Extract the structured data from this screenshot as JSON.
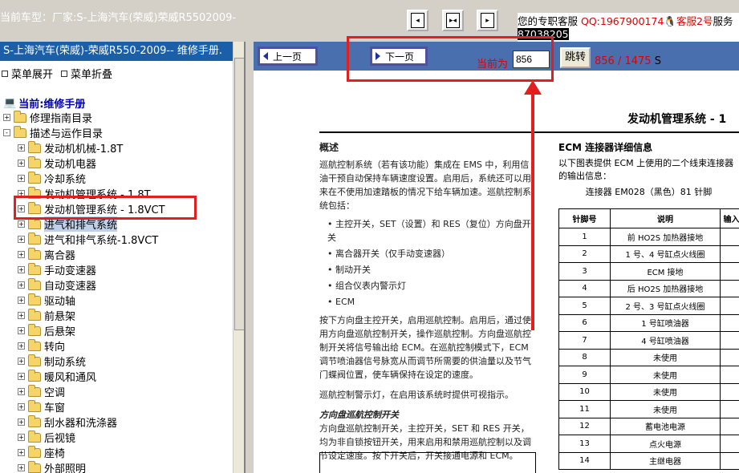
{
  "topbar": {
    "car_model": "当前车型：厂家:S-上海汽车(荣威)荣威R5502009-",
    "service_label": "您的专职客服",
    "qq": "QQ:1967900174",
    "csr": "客服2号",
    "csr_suffix": "服务",
    "phone": "87038205"
  },
  "tree": {
    "title": "S-上海汽车(荣威)-荣威R550-2009-- 维修手册.",
    "expand_all": "菜单展开",
    "collapse_all": "菜单折叠",
    "current": "当前:维修手册",
    "items": [
      {
        "label": "修理指南目录",
        "sign": "+"
      },
      {
        "label": "描述与运作目录",
        "sign": "-"
      },
      {
        "label": "发动机机械-1.8T",
        "sign": "+"
      },
      {
        "label": "发动机电器",
        "sign": "+"
      },
      {
        "label": "冷却系统",
        "sign": "+"
      },
      {
        "label": "发动机管理系统 - 1.8T",
        "sign": "+"
      },
      {
        "label": "发动机管理系统 - 1.8VCT",
        "sign": "+"
      },
      {
        "label": "进气和排气系统",
        "sign": "+"
      },
      {
        "label": "进气和排气系统-1.8VCT",
        "sign": "+"
      },
      {
        "label": "离合器",
        "sign": "+"
      },
      {
        "label": "手动变速器",
        "sign": "+"
      },
      {
        "label": "自动变速器",
        "sign": "+"
      },
      {
        "label": "驱动轴",
        "sign": "+"
      },
      {
        "label": "前悬架",
        "sign": "+"
      },
      {
        "label": "后悬架",
        "sign": "+"
      },
      {
        "label": "转向",
        "sign": "+"
      },
      {
        "label": "制动系统",
        "sign": "+"
      },
      {
        "label": "暖风和通风",
        "sign": "+"
      },
      {
        "label": "空调",
        "sign": "+"
      },
      {
        "label": "车窗",
        "sign": "+"
      },
      {
        "label": "刮水器和洗涤器",
        "sign": "+"
      },
      {
        "label": "后视镜",
        "sign": "+"
      },
      {
        "label": "座椅",
        "sign": "+"
      },
      {
        "label": "外部照明",
        "sign": "+"
      }
    ]
  },
  "nav": {
    "prev": "上一页",
    "next": "下一页",
    "current_label": "当前为",
    "page_value": "856",
    "jump": "跳转",
    "pages": "856 / 1475",
    "s": "S"
  },
  "doc": {
    "heading": "发动机管理系统 - 1",
    "left_h": "概述",
    "left_p1": "巡航控制系统（若有该功能）集成在 EMS 中，利用信油干预自动保持车辆速度设置。启用后，系统还可以用来在不使用加速踏板的情况下给车辆加速。巡航控制系统包括：",
    "bullets": [
      "主控开关，SET（设置）和 RES（复位）方向盘开关",
      "离合器开关（仅手动变速器）",
      "制动开关",
      "组合仪表内警示灯",
      "ECM"
    ],
    "left_p2": "按下方向盘主控开关，启用巡航控制。启用后，通过使用方向盘巡航控制开关，操作巡航控制。方向盘巡航控制开关将信号输出给 ECM。在巡航控制模式下，ECM调节喷油器信号脉宽从而调节所需要的供油量以及节气门蝶阀位置，使车辆保持在设定的速度。",
    "left_p3": "巡航控制警示灯，在启用该系统时提供可视指示。",
    "left_ih": "方向盘巡航控制开关",
    "left_p4": "方向盘巡航控制开关，主控开关，SET 和 RES 开关，均为非自锁按钮开关，用来启用和禁用巡航控制以及调节设定速度。按下开关后，开关接通电源和 ECM。",
    "right_h": "ECM 连接器详细信息",
    "right_p": "以下图表提供 ECM 上使用的二个线束连接器的输出信息：",
    "right_cap": "连接器 EM028（黑色）81 针脚",
    "table_headers": [
      "针脚号",
      "说明",
      "输入"
    ],
    "table_rows": [
      [
        "1",
        "前 HO2S 加热器接地"
      ],
      [
        "2",
        "1 号、4 号缸点火线圈"
      ],
      [
        "3",
        "ECM 接地"
      ],
      [
        "4",
        "后 HO2S 加热器接地"
      ],
      [
        "5",
        "2 号、3 号缸点火线圈"
      ],
      [
        "6",
        "1 号缸喷油器"
      ],
      [
        "7",
        "4 号缸喷油器"
      ],
      [
        "8",
        "未使用"
      ],
      [
        "9",
        "未使用"
      ],
      [
        "10",
        "未使用"
      ],
      [
        "11",
        "未使用"
      ],
      [
        "12",
        "蓄电池电源"
      ],
      [
        "13",
        "点火电源"
      ],
      [
        "14",
        "主继电器"
      ]
    ]
  },
  "colors": {
    "highlight": "#e02020",
    "tree_title_bg": "#1b5fa8",
    "nav_bar_bg": "#4a6fae"
  }
}
